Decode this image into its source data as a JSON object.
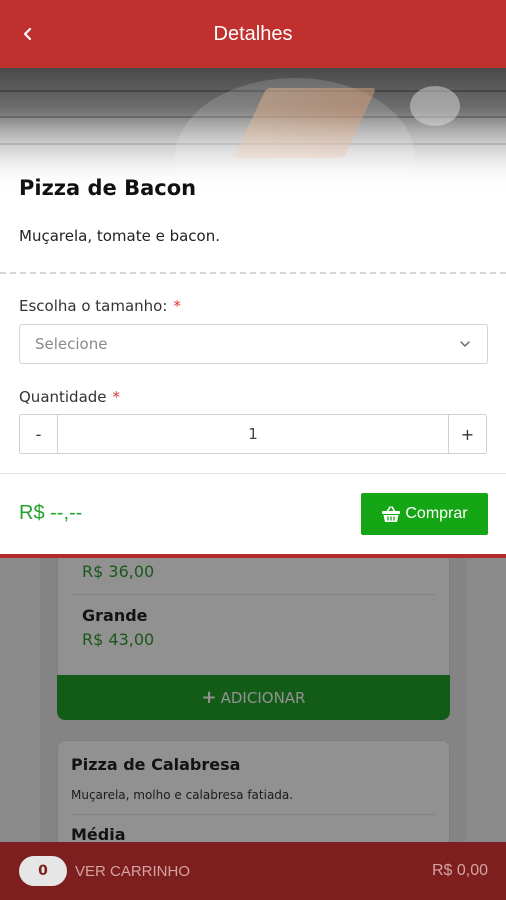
{
  "header": {
    "title": "Detalhes"
  },
  "product": {
    "name": "Pizza de Bacon",
    "description": "Muçarela, tomate e bacon.",
    "size_label": "Escolha o tamanho:",
    "size_placeholder": "Selecione",
    "quantity_label": "Quantidade",
    "required_mark": "*",
    "quantity_minus": "-",
    "quantity_value": "1",
    "quantity_plus": "+",
    "price": "R$ --,--",
    "buy_label": "Comprar"
  },
  "background_list": {
    "card1": {
      "first_price": "R$ 36,00",
      "size_name": "Grande",
      "size_price": "R$ 43,00",
      "add_label": "ADICIONAR",
      "add_icon": "+"
    },
    "card2": {
      "name": "Pizza de Calabresa",
      "description": "Muçarela, molho e calabresa fatiada.",
      "size_name": "Média"
    }
  },
  "cart": {
    "count": "0",
    "label": "VER CARRINHO",
    "total": "R$ 0,00"
  },
  "colors": {
    "header": "#c0302f",
    "buy_button": "#14a614",
    "price": "#22a32a",
    "cart_bar": "#7c1f1e"
  }
}
